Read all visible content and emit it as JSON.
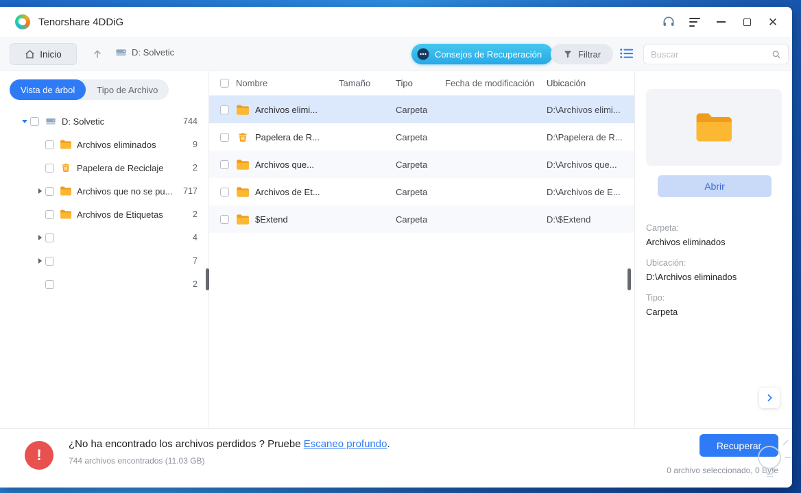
{
  "window": {
    "title": "Tenorshare 4DDiG"
  },
  "toolbar": {
    "home_label": "Inicio",
    "drive_label": "D: Solvetic",
    "tips_label": "Consejos de Recuperación",
    "filter_label": "Filtrar",
    "search_placeholder": "Buscar"
  },
  "sidebar": {
    "tabs": [
      {
        "label": "Vista de árbol"
      },
      {
        "label": "Tipo de Archivo"
      }
    ],
    "tree": [
      {
        "label": "D: Solvetic",
        "count": "744",
        "icon": "drive",
        "arrow": "down",
        "level": 0
      },
      {
        "label": "Archivos eliminados",
        "count": "9",
        "icon": "folder",
        "arrow": "none",
        "level": 1
      },
      {
        "label": "Papelera de Reciclaje",
        "count": "2",
        "icon": "trash",
        "arrow": "none",
        "level": 1
      },
      {
        "label": "Archivos que no se pu...",
        "count": "717",
        "icon": "folder",
        "arrow": "right",
        "level": 1
      },
      {
        "label": "Archivos de Etiquetas",
        "count": "2",
        "icon": "folder",
        "arrow": "none",
        "level": 1
      },
      {
        "label": "",
        "count": "4",
        "icon": "none",
        "arrow": "right",
        "level": 1
      },
      {
        "label": "",
        "count": "7",
        "icon": "none",
        "arrow": "right",
        "level": 1
      },
      {
        "label": "",
        "count": "2",
        "icon": "none",
        "arrow": "none",
        "level": 1
      }
    ]
  },
  "table": {
    "columns": [
      "Nombre",
      "Tamaño",
      "Tipo",
      "Fecha de modificación",
      "Ubicación"
    ],
    "rows": [
      {
        "name": "Archivos elimi...",
        "size": "",
        "type": "Carpeta",
        "date": "",
        "location": "D:\\Archivos elimi...",
        "icon": "folder",
        "selected": true
      },
      {
        "name": "Papelera de R...",
        "size": "",
        "type": "Carpeta",
        "date": "",
        "location": "D:\\Papelera de R...",
        "icon": "trash",
        "selected": false
      },
      {
        "name": "Archivos que...",
        "size": "",
        "type": "Carpeta",
        "date": "",
        "location": "D:\\Archivos que...",
        "icon": "folder",
        "selected": false
      },
      {
        "name": "Archivos de Et...",
        "size": "",
        "type": "Carpeta",
        "date": "",
        "location": "D:\\Archivos de E...",
        "icon": "folder",
        "selected": false
      },
      {
        "name": "$Extend",
        "size": "",
        "type": "Carpeta",
        "date": "",
        "location": "D:\\$Extend",
        "icon": "folder",
        "selected": false
      }
    ]
  },
  "preview": {
    "open_label": "Abrir",
    "fields": [
      {
        "label": "Carpeta:",
        "value": "Archivos eliminados"
      },
      {
        "label": "Ubicación:",
        "value": "D:\\Archivos eliminados"
      },
      {
        "label": "Tipo:",
        "value": "Carpeta"
      }
    ]
  },
  "footer": {
    "message_before_link": "¿No ha encontrado los archivos perdidos ? Pruebe ",
    "link_label": "Escaneo profundo",
    "message_after_link": ".",
    "stats": "744 archivos encontrados (11.03 GB)",
    "recover_label": "Recuperar",
    "selection_status": "0 archivo seleccionado, 0 Byte"
  },
  "colors": {
    "accent_blue": "#2f7bf5",
    "tips_cyan": "#2fb9e9",
    "folder_orange": "#f6a723",
    "alert_red": "#e8514d",
    "selected_row": "#dce8fb"
  }
}
